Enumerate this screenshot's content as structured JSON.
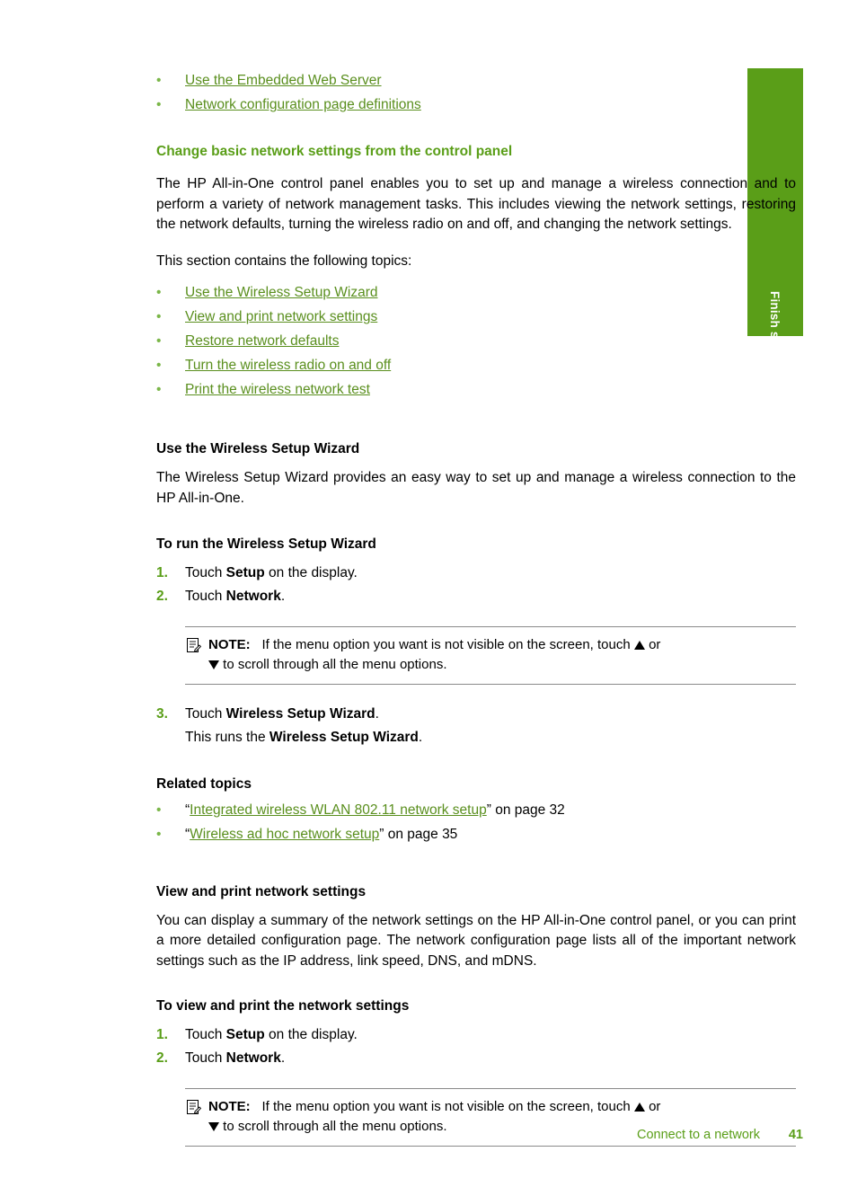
{
  "side_tab": {
    "label": "Finish setup",
    "color": "#5a9e18"
  },
  "top_links": [
    "Use the Embedded Web Server",
    "Network configuration page definitions"
  ],
  "section": {
    "heading": "Change basic network settings from the control panel",
    "paragraph": "The HP All-in-One control panel enables you to set up and manage a wireless connection and to perform a variety of network management tasks. This includes viewing the network settings, restoring the network defaults, turning the wireless radio on and off, and changing the network settings.",
    "topics_intro": "This section contains the following topics:",
    "topics": [
      "Use the Wireless Setup Wizard",
      "View and print network settings",
      "Restore network defaults",
      "Turn the wireless radio on and off",
      "Print the wireless network test"
    ]
  },
  "wizard": {
    "heading": "Use the Wireless Setup Wizard",
    "paragraph": "The Wireless Setup Wizard provides an easy way to set up and manage a wireless connection to the HP All-in-One.",
    "proc_heading": "To run the Wireless Setup Wizard",
    "steps": [
      {
        "num": "1.",
        "pre": "Touch ",
        "bold": "Setup",
        "post": " on the display."
      },
      {
        "num": "2.",
        "pre": "Touch ",
        "bold": "Network",
        "post": "."
      },
      {
        "num": "3.",
        "pre": "Touch ",
        "bold": "Wireless Setup Wizard",
        "post": "."
      }
    ],
    "step3_line2_pre": "This runs the ",
    "step3_line2_bold": "Wireless Setup Wizard",
    "step3_line2_post": ".",
    "note": {
      "label": "NOTE:",
      "text_part1": "If the menu option you want is not visible on the screen, touch",
      "text_part2": "or",
      "text_part3": "to scroll through all the menu options."
    },
    "related_heading": "Related topics",
    "related": [
      {
        "quote_open": "“",
        "link": "Integrated wireless WLAN 802.11 network setup",
        "quote_close": "”",
        "tail": " on page 32"
      },
      {
        "quote_open": "“",
        "link": "Wireless ad hoc network setup",
        "quote_close": "”",
        "tail": " on page 35"
      }
    ]
  },
  "viewprint": {
    "heading": "View and print network settings",
    "paragraph": "You can display a summary of the network settings on the HP All-in-One control panel, or you can print a more detailed configuration page. The network configuration page lists all of the important network settings such as the IP address, link speed, DNS, and mDNS.",
    "proc_heading": "To view and print the network settings",
    "steps": [
      {
        "num": "1.",
        "pre": "Touch ",
        "bold": "Setup",
        "post": " on the display."
      },
      {
        "num": "2.",
        "pre": "Touch ",
        "bold": "Network",
        "post": "."
      }
    ],
    "note": {
      "label": "NOTE:",
      "text_part1": "If the menu option you want is not visible on the screen, touch",
      "text_part2": "or",
      "text_part3": "to scroll through all the menu options."
    }
  },
  "footer": {
    "text": "Connect to a network",
    "page": "41"
  }
}
